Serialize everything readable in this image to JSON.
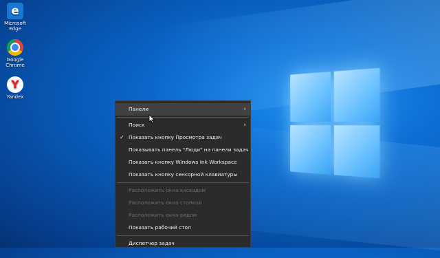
{
  "desktop": {
    "icons": [
      {
        "label": "Microsoft Edge",
        "icon": "edge-icon"
      },
      {
        "label": "Google Chrome",
        "icon": "chrome-icon"
      },
      {
        "label": "Yandex",
        "icon": "yandex-icon"
      }
    ]
  },
  "context_menu": {
    "items": [
      {
        "label": "Панели",
        "submenu": true,
        "state": "hover"
      },
      {
        "label": "Поиск",
        "submenu": true
      },
      {
        "label": "Показать кнопку Просмотра задач",
        "checked": true
      },
      {
        "label": "Показывать панель \"Люди\" на панели задач"
      },
      {
        "label": "Показать кнопку Windows Ink Workspace"
      },
      {
        "label": "Показать кнопку сенсорной клавиатуры"
      },
      {
        "label": "Расположить окна каскадом",
        "disabled": true
      },
      {
        "label": "Расположить окна стопкой",
        "disabled": true
      },
      {
        "label": "Расположить окна рядом",
        "disabled": true
      },
      {
        "label": "Показать рабочий стол"
      },
      {
        "label": "Диспетчер задач"
      }
    ],
    "glyphs": {
      "submenu": "›",
      "check": "✓"
    }
  },
  "colors": {
    "menu_bg": "#2b2b2b",
    "menu_hover": "#414141",
    "menu_text": "#f0f0f0",
    "menu_disabled": "#6d6d6d",
    "wallpaper": "#0859b6"
  }
}
